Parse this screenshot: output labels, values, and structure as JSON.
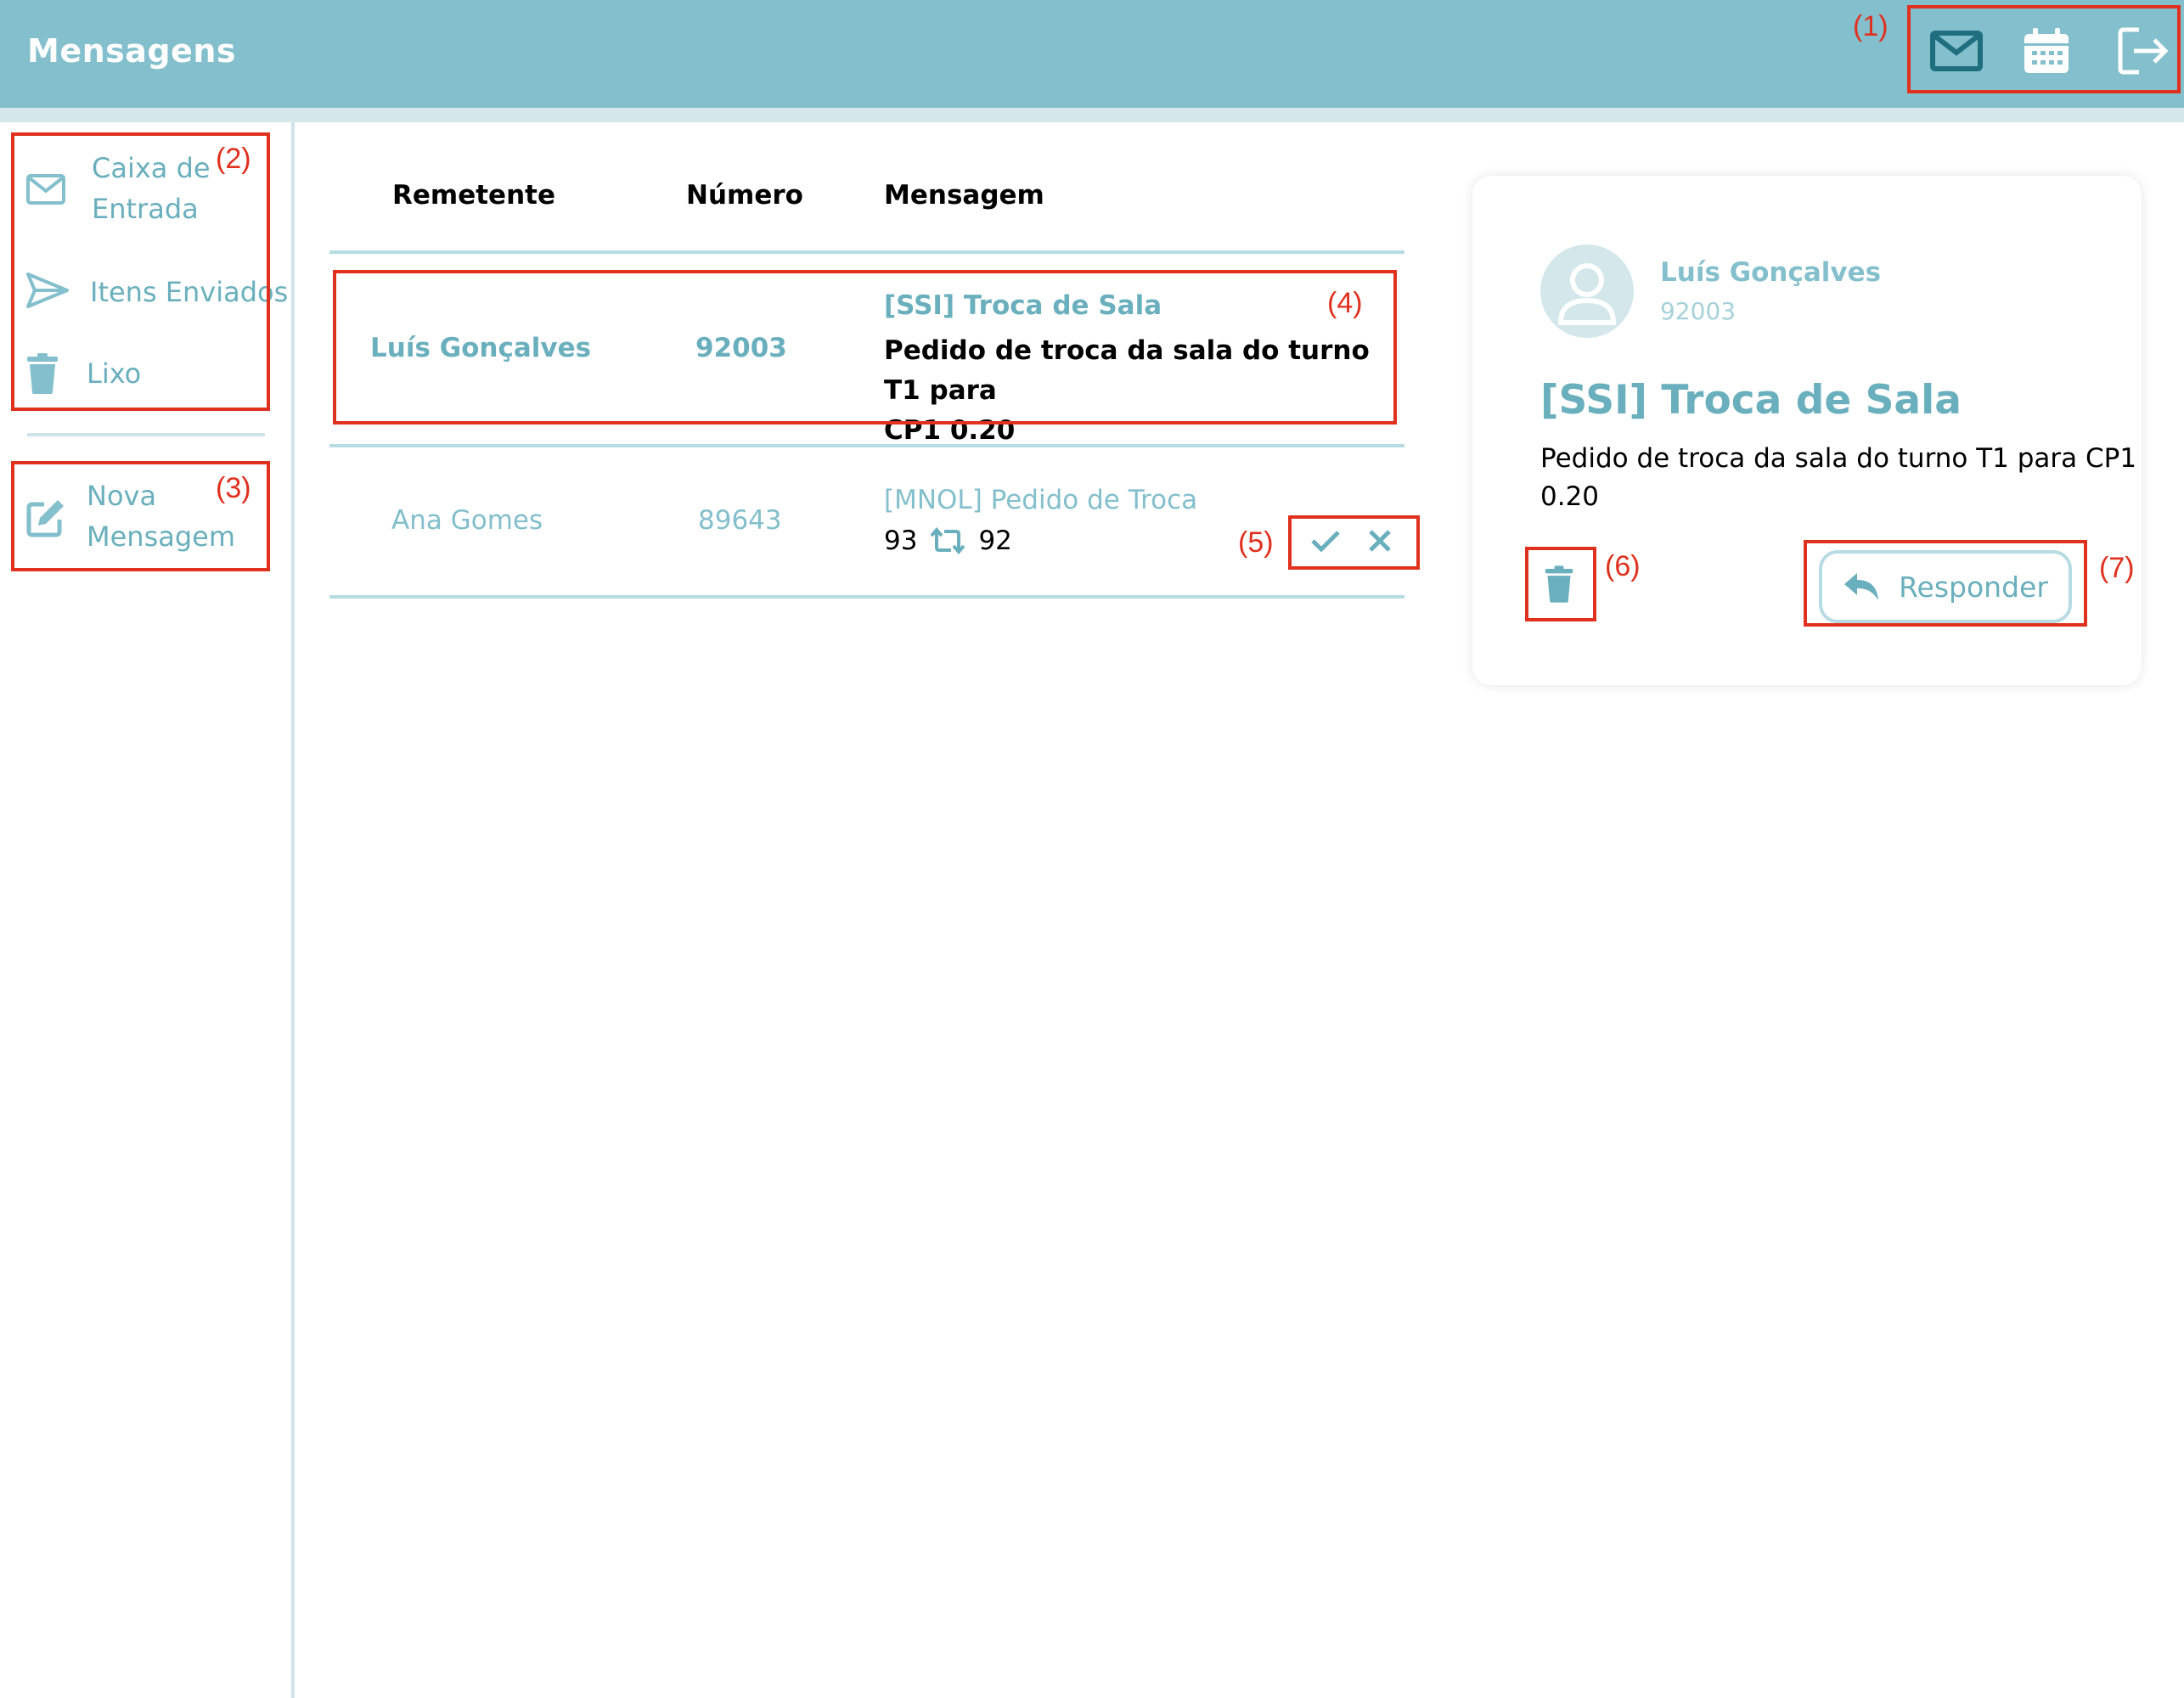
{
  "header": {
    "title": "Mensagens",
    "icons": [
      "mail-icon",
      "calendar-icon",
      "logout-icon"
    ]
  },
  "sidebar": {
    "items": [
      {
        "label_line1": "Caixa de",
        "label_line2": "Entrada",
        "icon": "mail-icon"
      },
      {
        "label": "Itens Enviados",
        "icon": "send-icon"
      },
      {
        "label": "Lixo",
        "icon": "trash-icon"
      }
    ],
    "new_message": {
      "label_line1": "Nova",
      "label_line2": "Mensagem",
      "icon": "edit-icon"
    }
  },
  "table": {
    "headers": [
      "Remetente",
      "Número",
      "Mensagem"
    ],
    "rows": [
      {
        "sender": "Luís Gonçalves",
        "number": "92003",
        "subject": "[SSI] Troca de Sala",
        "body_line1": "Pedido de troca da sala do turno T1 para",
        "body_line2": "CP1 0.20"
      },
      {
        "sender": "Ana Gomes",
        "number": "89643",
        "subject": "[MNOL] Pedido de Troca",
        "swap_from": "93",
        "swap_to": "92"
      }
    ]
  },
  "detail": {
    "sender": "Luís Gonçalves",
    "number": "92003",
    "subject": "[SSI] Troca de Sala",
    "body_line1": "Pedido de troca da sala do turno T1 para CP1",
    "body_line2": "0.20",
    "reply_label": "Responder"
  },
  "annotations": [
    "(1)",
    "(2)",
    "(3)",
    "(4)",
    "(5)",
    "(6)",
    "(7)"
  ],
  "colors": {
    "header_bg": "#83bfcc",
    "accent": "#6aafbd",
    "annotation": "#e0301e"
  }
}
